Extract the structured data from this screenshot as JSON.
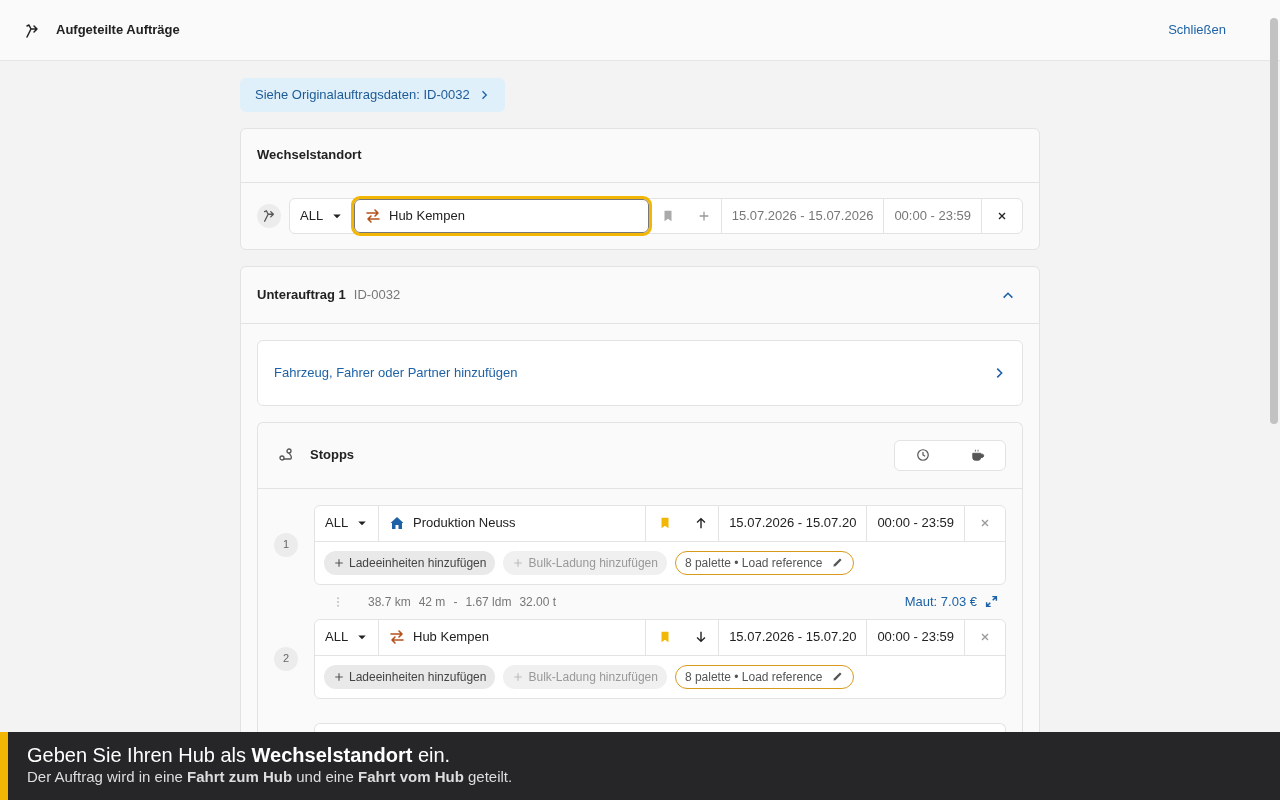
{
  "header": {
    "title": "Aufgeteilte Aufträge",
    "close_label": "Schließen"
  },
  "original_link": "Siehe Originalauftragsdaten: ID-0032",
  "exchange": {
    "title": "Wechselstandort",
    "type": "ALL",
    "location": {
      "name": "Hub Kempen",
      "kind": "hub"
    },
    "focused": true,
    "bookmarked": false,
    "date_range": "15.07.2026 - 15.07.2026",
    "time": "00:00 - 23:59"
  },
  "suborder": {
    "title": "Unterauftrag 1",
    "id": "ID-0032",
    "expanded": true,
    "assign_link": "Fahrzeug, Fahrer oder Partner hinzufügen",
    "stops_title": "Stopps",
    "stops": [
      {
        "number": "1",
        "type": "ALL",
        "location": {
          "name": "Produktion Neuss",
          "kind": "home"
        },
        "bookmarked": true,
        "reorder": {
          "kind": "up"
        },
        "date_range": "15.07.2026 - 15.07.20",
        "time": "00:00 - 23:59",
        "actions": [
          {
            "label": "Ladeeinheiten hinzufügen",
            "disabled": false
          },
          {
            "label": "Bulk-Ladung hinzufügen",
            "disabled": true
          }
        ],
        "load": "8 palette • Load reference",
        "leg": {
          "metrics": [
            "38.7 km",
            "42 m",
            "-",
            "1.67 ldm",
            "32.00 t"
          ],
          "toll": "Maut: 7.03 €"
        }
      },
      {
        "number": "2",
        "type": "ALL",
        "location": {
          "name": "Hub Kempen",
          "kind": "hub"
        },
        "bookmarked": true,
        "reorder": {
          "kind": "down"
        },
        "date_range": "15.07.2026 - 15.07.20",
        "time": "00:00 - 23:59",
        "actions": [
          {
            "label": "Ladeeinheiten hinzufügen",
            "disabled": false
          },
          {
            "label": "Bulk-Ladung hinzufügen",
            "disabled": true
          }
        ],
        "load": "8 palette • Load reference"
      }
    ]
  },
  "banner": {
    "headline": "Geben Sie Ihren Hub als **Wechselstandort** ein.",
    "text": "Der Auftrag wird in eine **Fahrt zum Hub** und eine **Fahrt vom Hub** geteilt."
  }
}
